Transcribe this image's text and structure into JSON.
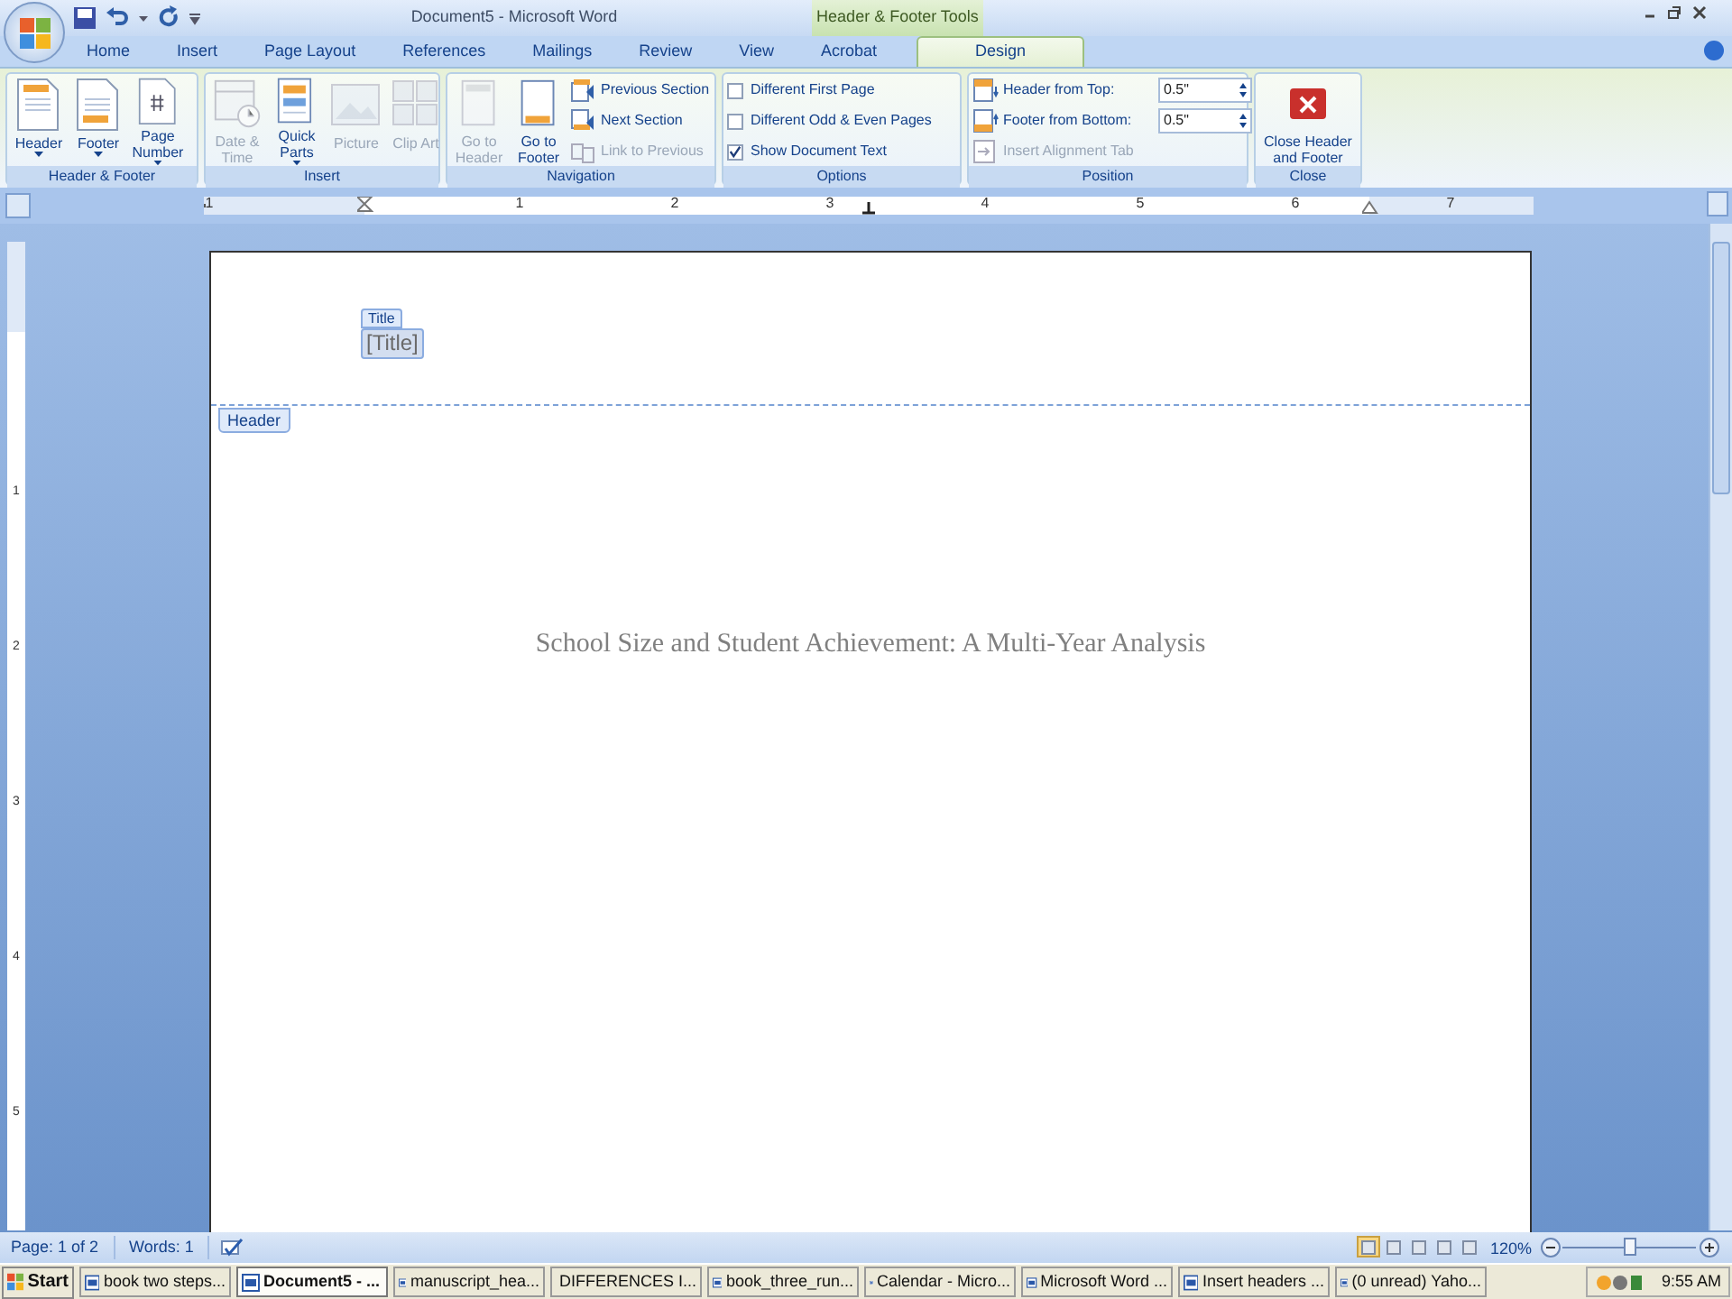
{
  "window": {
    "title": "Document5 - Microsoft Word",
    "contextual_tab": "Header & Footer Tools"
  },
  "tabs": [
    {
      "label": "Home",
      "selected": false
    },
    {
      "label": "Insert",
      "selected": false
    },
    {
      "label": "Page Layout",
      "selected": false
    },
    {
      "label": "References",
      "selected": false
    },
    {
      "label": "Mailings",
      "selected": false
    },
    {
      "label": "Review",
      "selected": false
    },
    {
      "label": "View",
      "selected": false
    },
    {
      "label": "Acrobat",
      "selected": false
    },
    {
      "label": "Design",
      "selected": true
    }
  ],
  "ribbon_groups": [
    {
      "label": "Header & Footer",
      "items": [
        {
          "kind": "large",
          "label": "Header",
          "dropdown": true,
          "disabled": false
        },
        {
          "kind": "large",
          "label": "Footer",
          "dropdown": true,
          "disabled": false
        },
        {
          "kind": "large",
          "label": "Page Number",
          "dropdown": true,
          "disabled": false
        }
      ]
    },
    {
      "label": "Insert",
      "items": [
        {
          "kind": "large",
          "label": "Date & Time",
          "dropdown": false,
          "disabled": true
        },
        {
          "kind": "large",
          "label": "Quick Parts",
          "dropdown": true,
          "disabled": false
        },
        {
          "kind": "large",
          "label": "Picture",
          "dropdown": false,
          "disabled": true
        },
        {
          "kind": "large",
          "label": "Clip Art",
          "dropdown": false,
          "disabled": true
        }
      ]
    },
    {
      "label": "Navigation",
      "items": [
        {
          "kind": "large",
          "label": "Go to Header",
          "dropdown": false,
          "disabled": true
        },
        {
          "kind": "large",
          "label": "Go to Footer",
          "dropdown": false,
          "disabled": false
        },
        {
          "kind": "small",
          "label": "Previous Section",
          "disabled": false
        },
        {
          "kind": "small",
          "label": "Next Section",
          "disabled": false
        },
        {
          "kind": "small",
          "label": "Link to Previous",
          "disabled": true
        }
      ]
    },
    {
      "label": "Options",
      "items": [
        {
          "kind": "checkbox",
          "label": "Different First Page",
          "checked": false
        },
        {
          "kind": "checkbox",
          "label": "Different Odd & Even Pages",
          "checked": false
        },
        {
          "kind": "checkbox",
          "label": "Show Document Text",
          "checked": true
        }
      ]
    },
    {
      "label": "Position",
      "items": [
        {
          "kind": "spin",
          "label": "Header from Top:",
          "value": "0.5\""
        },
        {
          "kind": "spin",
          "label": "Footer from Bottom:",
          "value": "0.5\""
        },
        {
          "kind": "small",
          "label": "Insert Alignment Tab",
          "disabled": true
        }
      ]
    },
    {
      "label": "Close",
      "items": [
        {
          "kind": "close",
          "label": "Close Header and Footer"
        }
      ]
    }
  ],
  "ruler": {
    "labels": [
      "1",
      "1",
      "2",
      "3",
      "4",
      "5",
      "6",
      "7"
    ]
  },
  "vertical_ruler": {
    "labels": [
      "1",
      "2",
      "3",
      "4",
      "5"
    ]
  },
  "page": {
    "header_control_tag": "Title",
    "header_control_text": "[Title]",
    "header_tab": "Header",
    "body_text": "School Size and Student Achievement: A Multi-Year Analysis"
  },
  "status_bar": {
    "page": "Page: 1 of 2",
    "words": "Words: 1",
    "views": [
      {
        "selected": true
      },
      {
        "selected": false
      },
      {
        "selected": false
      },
      {
        "selected": false
      },
      {
        "selected": false
      }
    ],
    "zoom": "120%",
    "zoom_level": {
      "level": 0.5
    }
  },
  "taskbar": {
    "start": "Start",
    "tasks": [
      {
        "label": "book two steps...",
        "selected": false
      },
      {
        "label": "Document5 - ...",
        "selected": true
      },
      {
        "label": "manuscript_hea...",
        "selected": false
      },
      {
        "label": "DIFFERENCES I...",
        "selected": false
      },
      {
        "label": "book_three_run...",
        "selected": false
      },
      {
        "label": "Calendar - Micro...",
        "selected": false
      },
      {
        "label": "Microsoft Word ...",
        "selected": false
      },
      {
        "label": "Insert headers ...",
        "selected": false
      },
      {
        "label": "(0 unread) Yaho...",
        "selected": false
      }
    ],
    "clock": "9:55 AM"
  }
}
